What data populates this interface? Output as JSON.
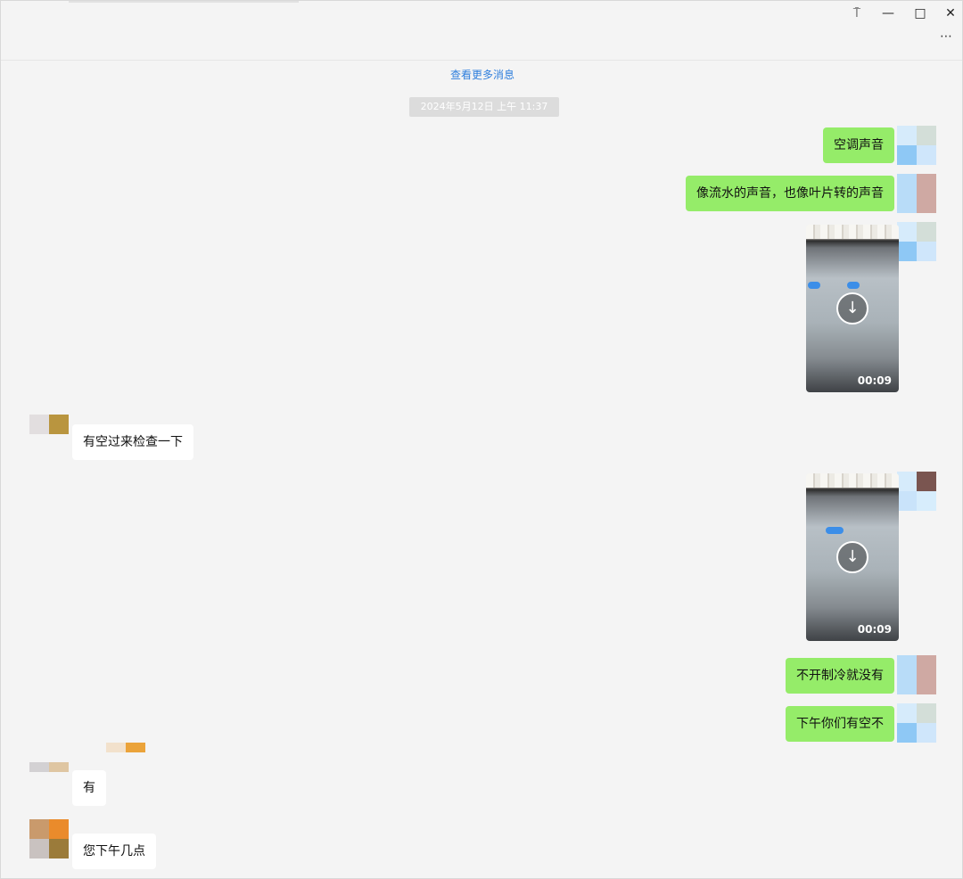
{
  "window": {
    "controls": {
      "pin": "⍑",
      "minimize": "—",
      "maximize": "□",
      "close": "✕",
      "more": "⋯"
    }
  },
  "chat": {
    "more_messages_link": "查看更多消息",
    "timestamp": "2024年5月12日 上午 11:37",
    "messages": [
      {
        "text": "空调声音"
      },
      {
        "text": "像流水的声音，也像叶片转的声音"
      },
      {
        "video_duration": "00:09"
      },
      {
        "text": "有空过来检查一下"
      },
      {
        "video_duration": "00:09"
      },
      {
        "text": "不开制冷就没有"
      },
      {
        "text": "下午你们有空不"
      },
      {
        "text": "有"
      },
      {
        "text": "您下午几点"
      }
    ],
    "download_icon_glyph": "↓"
  },
  "colors": {
    "outgoing_bubble": "#95ec69",
    "incoming_bubble": "#ffffff",
    "link": "#2f7fdd",
    "background": "#f4f4f4"
  }
}
